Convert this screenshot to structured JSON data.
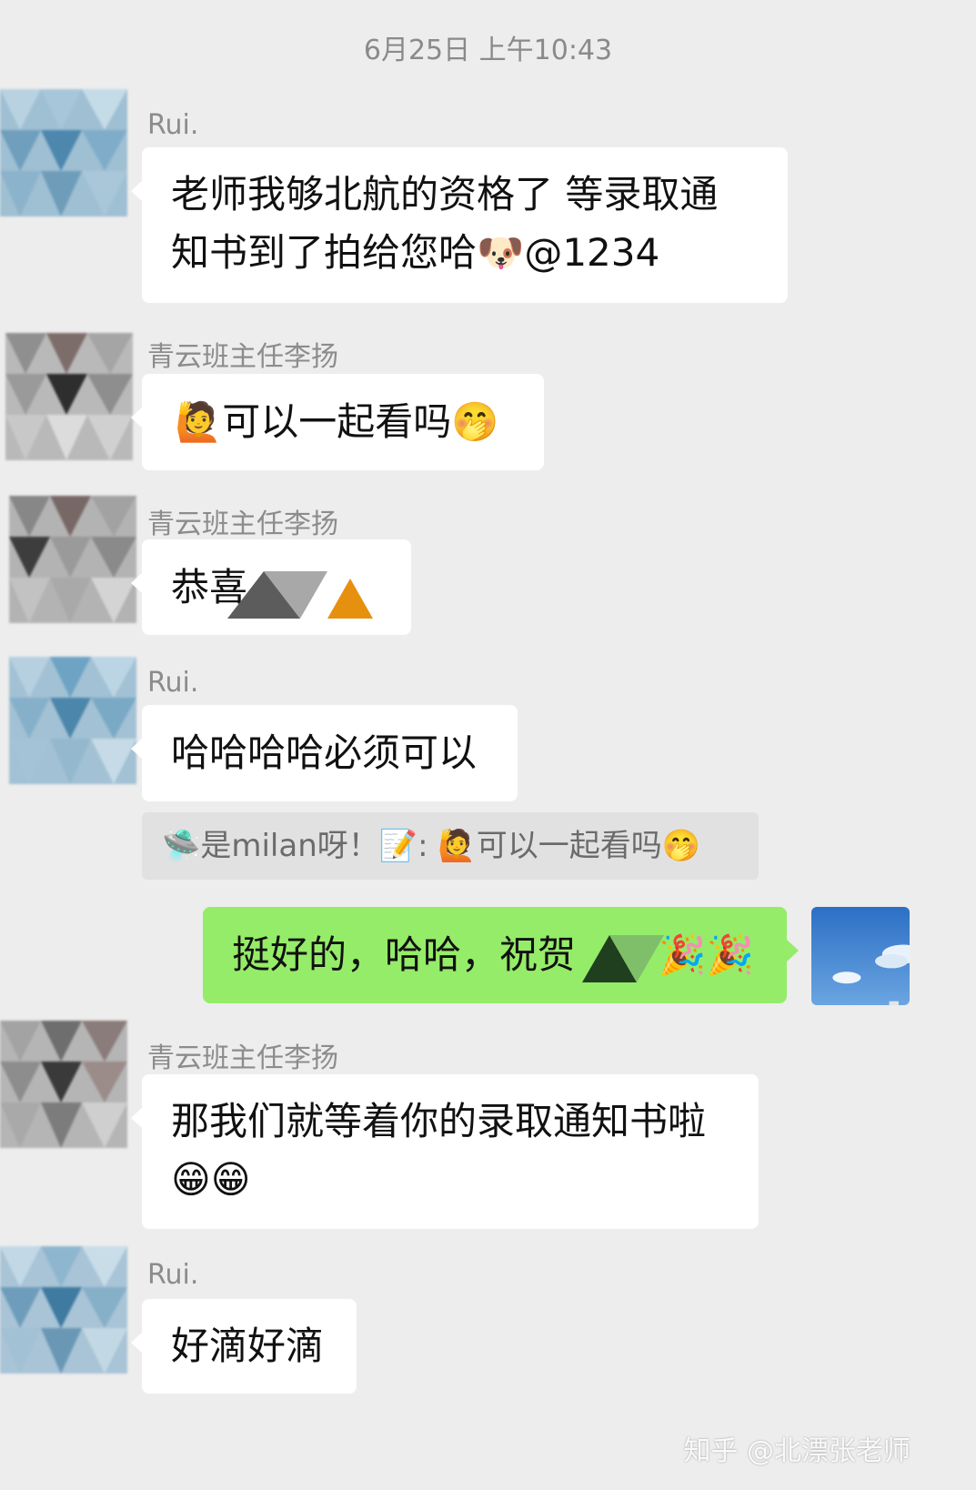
{
  "timestamp": "6月25日 上午10:43",
  "messages": [
    {
      "sender": "Rui.",
      "line1": "老师我够北航的资格了  等录取通",
      "line2_text": "知书到了拍给您哈",
      "line2_emoji": "🐶",
      "line2_tail": "@1234"
    },
    {
      "sender": "青云班主任李扬",
      "emoji_before": "🙋",
      "text": "可以一起看吗",
      "emoji_after": "🤭"
    },
    {
      "sender": "青云班主任李扬",
      "text": "恭喜"
    },
    {
      "sender": "Rui.",
      "text": "哈哈哈哈必须可以",
      "quote": {
        "icon": "🛸",
        "name": "是milan呀！",
        "name_icon": "📝",
        "separator": ":",
        "emoji_before": "🙋",
        "text": "可以一起看吗",
        "emoji_after": "🤭"
      }
    },
    {
      "sender": "me",
      "text": "挺好的，哈哈，祝贺",
      "emojis": "🎉🎉"
    },
    {
      "sender": "青云班主任李扬",
      "text": "那我们就等着你的录取通知书啦",
      "emojis": "😁😁"
    },
    {
      "sender": "Rui.",
      "text": "好滴好滴"
    }
  ],
  "watermark": "知乎 @北漂张老师",
  "colors": {
    "background": "#ededed",
    "bubble_received": "#ffffff",
    "bubble_sent": "#95ec69",
    "quote_bg": "#e1e1e1",
    "sender_text": "#8c8c8c"
  }
}
